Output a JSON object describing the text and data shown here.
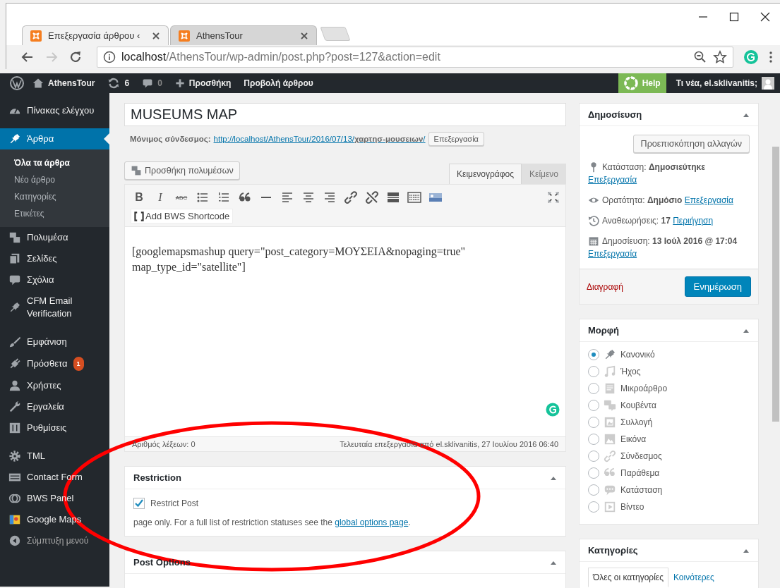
{
  "browser": {
    "tabs": [
      {
        "title": "Επεξεργασία άρθρου ‹",
        "selected": true
      },
      {
        "title": "AthensTour",
        "selected": false
      }
    ],
    "back": {
      "disabled": false
    },
    "forward": {
      "disabled": true
    },
    "url_host": "localhost",
    "url_path": "/AthensTour/wp-admin/post.php?post=127&action=edit"
  },
  "admin_bar": {
    "site": "AthensTour",
    "updates": "6",
    "comments": "0",
    "new": "Προσθήκη",
    "view": "Προβολή άρθρου",
    "help": "Help",
    "greeting": "Τι νέα, el.sklivanitis;"
  },
  "sidebar": {
    "groups": [
      [
        {
          "label": "Πίνακας ελέγχου",
          "selected": false
        }
      ],
      [
        {
          "label": "Άρθρα",
          "selected": true,
          "children": [
            {
              "label": "Όλα τα άρθρα",
              "selected": true
            },
            {
              "label": "Νέο άρθρο",
              "selected": false
            },
            {
              "label": "Κατηγορίες",
              "selected": false
            },
            {
              "label": "Ετικέτες",
              "selected": false
            }
          ]
        },
        {
          "label": "Πολυμέσα",
          "selected": false
        },
        {
          "label": "Σελίδες",
          "selected": false
        },
        {
          "label": "Σχόλια",
          "selected": false
        },
        {
          "label": "CFM Email Verification",
          "selected": false
        }
      ],
      [
        {
          "label": "Εμφάνιση",
          "selected": false
        },
        {
          "label": "Πρόσθετα",
          "selected": false,
          "badge": "1"
        },
        {
          "label": "Χρήστες",
          "selected": false
        },
        {
          "label": "Εργαλεία",
          "selected": false
        },
        {
          "label": "Ρυθμίσεις",
          "selected": false
        }
      ],
      [
        {
          "label": "TML",
          "selected": false
        },
        {
          "label": "Contact Form",
          "selected": false
        },
        {
          "label": "BWS Panel",
          "selected": false
        },
        {
          "label": "Google Maps",
          "selected": false
        },
        {
          "label": "Σύμπτυξη μενού",
          "selected": false,
          "kind": "collapse"
        }
      ]
    ]
  },
  "editor": {
    "title": "MUSEUMS MAP",
    "permalink_label": "Μόνιμος σύνδεσμος:",
    "permalink": "http://localhost/AthensTour/2016/07/13/**χαρτησ-μουσειων**/",
    "permalink_button": "Επεξεργασία",
    "media_button": "Προσθήκη πολυμέσων",
    "tabs": [
      {
        "label": "Κειμενογράφος",
        "selected": true
      },
      {
        "label": "Κείμενο",
        "selected": false
      }
    ],
    "toolbar": [
      {
        "kind": "bold",
        "label": "B"
      },
      {
        "kind": "italic",
        "label": "I"
      },
      {
        "kind": "strike",
        "label": "ABC"
      },
      {
        "kind": "bullets"
      },
      {
        "kind": "numbers"
      },
      {
        "kind": "quote"
      },
      {
        "kind": "rule"
      },
      {
        "kind": "align-left"
      },
      {
        "kind": "align-center"
      },
      {
        "kind": "align-right"
      },
      {
        "kind": "link"
      },
      {
        "kind": "unlink"
      },
      {
        "kind": "more"
      },
      {
        "kind": "keyboard"
      },
      {
        "kind": "gallery"
      }
    ],
    "shortcode_button": "Add BWS Shortcode",
    "content": "[googlemapsmashup query=\"post_category=ΜΟΥΣΕΙΑ&nopaging=true\" map_type_id=\"satellite\"]",
    "word_count": "Αριθμός λέξεων: 0",
    "last_edit": "Τελευταία επεξεργασία από el.sklivanitis, 27 Ιουλίου 2016 06:40"
  },
  "restriction": {
    "title": "Restriction",
    "checkbox": {
      "label": "Restrict Post",
      "checked": true
    },
    "note": "page only. For a full list of restriction statuses see the",
    "note_link": "global options page",
    "note_end": "."
  },
  "post_options": {
    "title": "Post Options"
  },
  "publish": {
    "title": "Δημοσίευση",
    "preview_button": "Προεπισκόπηση αλλαγών",
    "rows": [
      {
        "label": "Κατάσταση:",
        "value": "Δημοσιεύτηκε",
        "link": "Επεξεργασία"
      },
      {
        "label": "Ορατότητα:",
        "value": "Δημόσιο",
        "link": "Επεξεργασία"
      },
      {
        "label": "Αναθεωρήσεις:",
        "value": "17",
        "link": "Περιήγηση"
      },
      {
        "label": "Δημοσίευση:",
        "value": "13 Ιούλ 2016 @ 17:04",
        "link": "Επεξεργασία"
      }
    ],
    "delete": "Διαγραφή",
    "update": "Ενημέρωση"
  },
  "format": {
    "title": "Μορφή",
    "options": [
      {
        "label": "Κανονικό",
        "selected": true
      },
      {
        "label": "Ήχος",
        "selected": false
      },
      {
        "label": "Μικροάρθρο",
        "selected": false
      },
      {
        "label": "Κουβέντα",
        "selected": false
      },
      {
        "label": "Συλλογή",
        "selected": false
      },
      {
        "label": "Εικόνα",
        "selected": false
      },
      {
        "label": "Σύνδεσμος",
        "selected": false
      },
      {
        "label": "Παράθεμα",
        "selected": false
      },
      {
        "label": "Κατάσταση",
        "selected": false
      },
      {
        "label": "Βίντεο",
        "selected": false
      }
    ]
  },
  "categories": {
    "title": "Κατηγορίες",
    "tabs": [
      {
        "label": "Όλες οι κατηγορίες",
        "selected": true
      },
      {
        "label": "Κοινότερες",
        "selected": false
      }
    ]
  }
}
